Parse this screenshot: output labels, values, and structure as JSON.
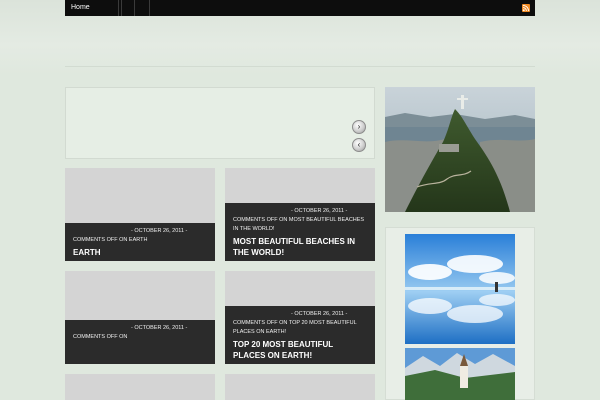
{
  "nav": {
    "home_label": "Home"
  },
  "icons": {
    "rss": "rss-icon",
    "next": "chevron-right-icon",
    "prev": "chevron-left-icon"
  },
  "slider": {
    "next_glyph": "›",
    "prev_glyph": "‹"
  },
  "posts": [
    {
      "meta": "- OCTOBER 26, 2011 -",
      "comments": "COMMENTS OFF ON EARTH",
      "title": "EARTH"
    },
    {
      "meta": "- OCTOBER 26, 2011 -",
      "comments": "COMMENTS OFF ON MOST BEAUTIFUL BEACHES IN THE WORLD!",
      "title": "MOST BEAUTIFUL BEACHES IN THE WORLD!"
    },
    {
      "meta": "- OCTOBER 26, 2011 -",
      "comments": "COMMENTS OFF ON",
      "title": ""
    },
    {
      "meta": "- OCTOBER 26, 2011 -",
      "comments": "COMMENTS OFF ON TOP 20 MOST BEAUTIFUL PLACES ON EARTH!",
      "title": "TOP 20 MOST BEAUTIFUL PLACES ON EARTH!"
    }
  ],
  "colors": {
    "page_bg": "#dfe8de",
    "topbar": "#0d0d0d",
    "post_overlay": "#2b2b2b",
    "rss": "#f08a24"
  }
}
